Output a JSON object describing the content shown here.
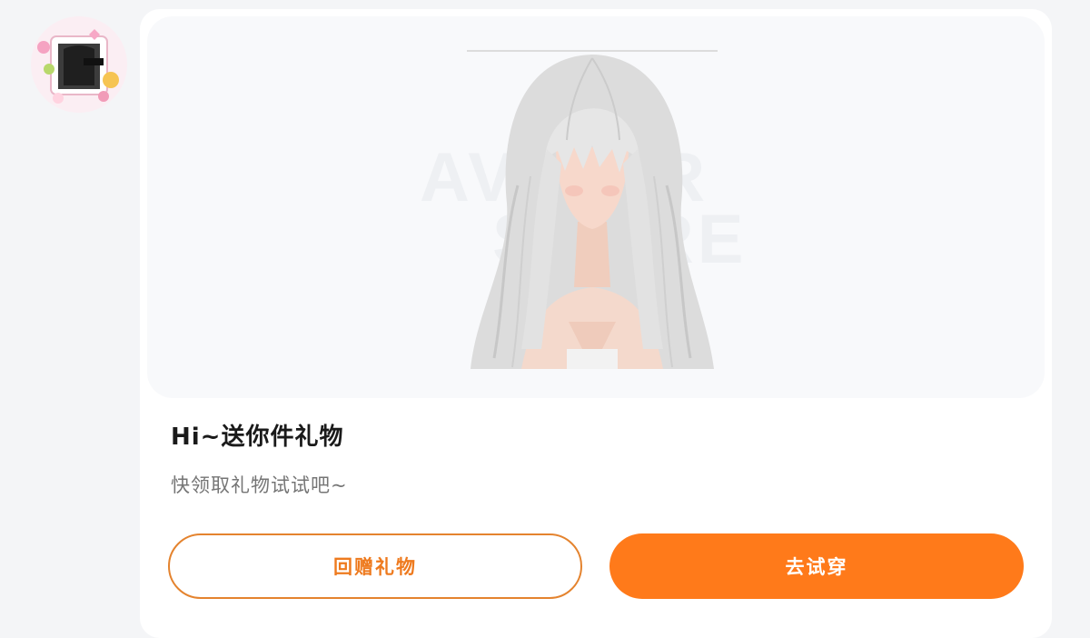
{
  "sender": {
    "avatar_icon": "sender-avatar-icon"
  },
  "gift_card": {
    "preview_icon": "hairstyle-preview-icon",
    "title": "Hi~送你件礼物",
    "subtitle": "快领取礼物试试吧~",
    "actions": {
      "return_gift_label": "回赠礼物",
      "try_on_label": "去试穿"
    }
  },
  "colors": {
    "accent": "#ff7a1a",
    "accent_outline": "#e4832e",
    "card_bg": "#ffffff",
    "page_bg": "#f4f5f7",
    "preview_bg": "#f8f9fb"
  }
}
